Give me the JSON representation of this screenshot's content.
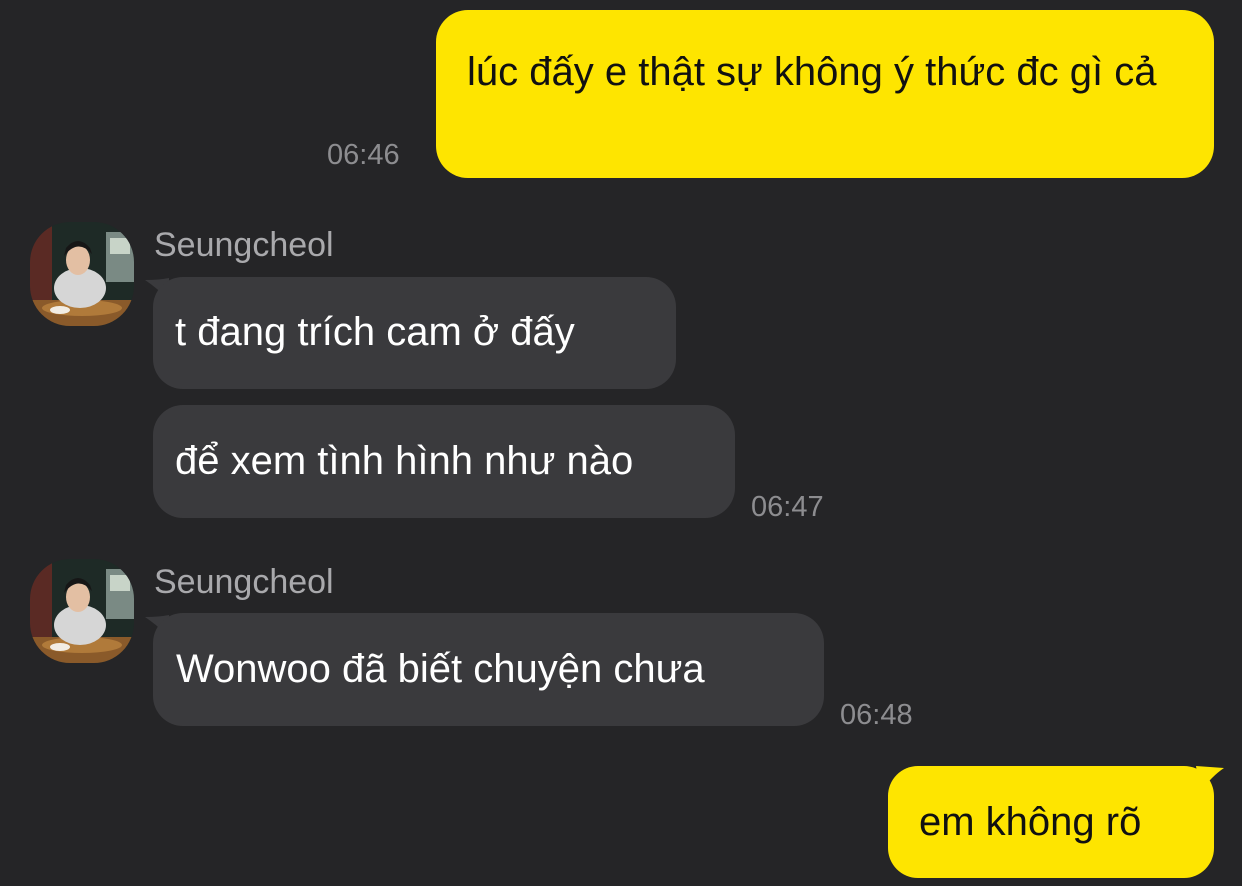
{
  "messages": [
    {
      "side": "out",
      "text": "lúc đấy e thật sự không ý thức đc gì cả",
      "time": "06:46"
    },
    {
      "side": "in",
      "sender": "Seungcheol",
      "avatar": "avatar-photo",
      "bubbles": [
        "t đang trích cam ở đấy",
        "để xem tình hình như nào"
      ],
      "time": "06:47"
    },
    {
      "side": "in",
      "sender": "Seungcheol",
      "avatar": "avatar-photo",
      "bubbles": [
        "Wonwoo đã biết chuyện chưa"
      ],
      "time": "06:48"
    },
    {
      "side": "out",
      "text": "em không rõ"
    }
  ],
  "colors": {
    "background": "#252527",
    "outgoing_bubble": "#FEE500",
    "incoming_bubble": "#3a3a3d",
    "timestamp": "#8d8d90",
    "sender_name": "#a9a9ac"
  }
}
